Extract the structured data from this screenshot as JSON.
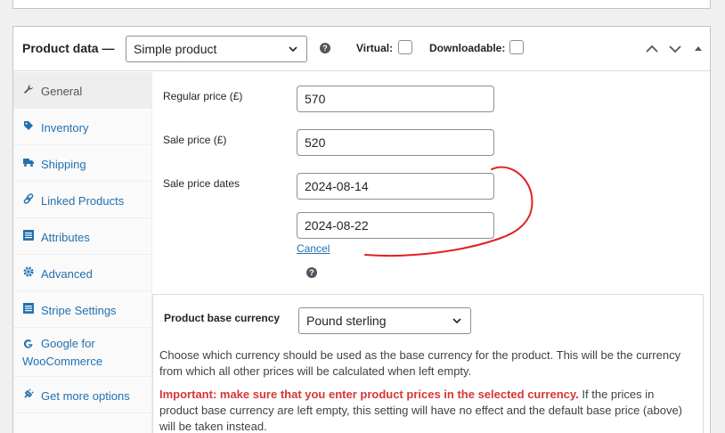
{
  "product_data": {
    "title": "Product data —",
    "product_type": "Simple product",
    "help_icon": "question-circle-icon",
    "virtual_label": "Virtual:",
    "virtual_checked": false,
    "downloadable_label": "Downloadable:",
    "downloadable_checked": false
  },
  "tabs": [
    {
      "label": "General",
      "icon": "wrench-icon",
      "active": true
    },
    {
      "label": "Inventory",
      "icon": "tag-icon"
    },
    {
      "label": "Shipping",
      "icon": "truck-icon"
    },
    {
      "label": "Linked Products",
      "icon": "link-icon"
    },
    {
      "label": "Attributes",
      "icon": "list-icon"
    },
    {
      "label": "Advanced",
      "icon": "gear-icon"
    },
    {
      "label": "Stripe Settings",
      "icon": "list-icon"
    },
    {
      "label": "Google for WooCommerce",
      "icon": "google-icon"
    },
    {
      "label": "Get more options",
      "icon": "plugin-icon"
    }
  ],
  "general": {
    "regular_price_label": "Regular price (£)",
    "regular_price": "570",
    "sale_price_label": "Sale price (£)",
    "sale_price": "520",
    "sale_dates_label": "Sale price dates",
    "sale_from": "2024-08-14",
    "sale_to": "2024-08-22",
    "cancel_label": "Cancel"
  },
  "currency": {
    "label": "Product base currency",
    "selected": "Pound sterling",
    "description": "Choose which currency should be used as the base currency for the product. This will be the currency from which all other prices will be calculated when left empty.",
    "important": "Important: make sure that you enter product prices in the selected currency.",
    "important_rest": " If the prices in product base currency are left empty, this setting will have no effect and the default base price (above) will be taken instead."
  },
  "colors": {
    "link": "#2271b1",
    "important": "#d63638",
    "annotation": "#e02020"
  }
}
